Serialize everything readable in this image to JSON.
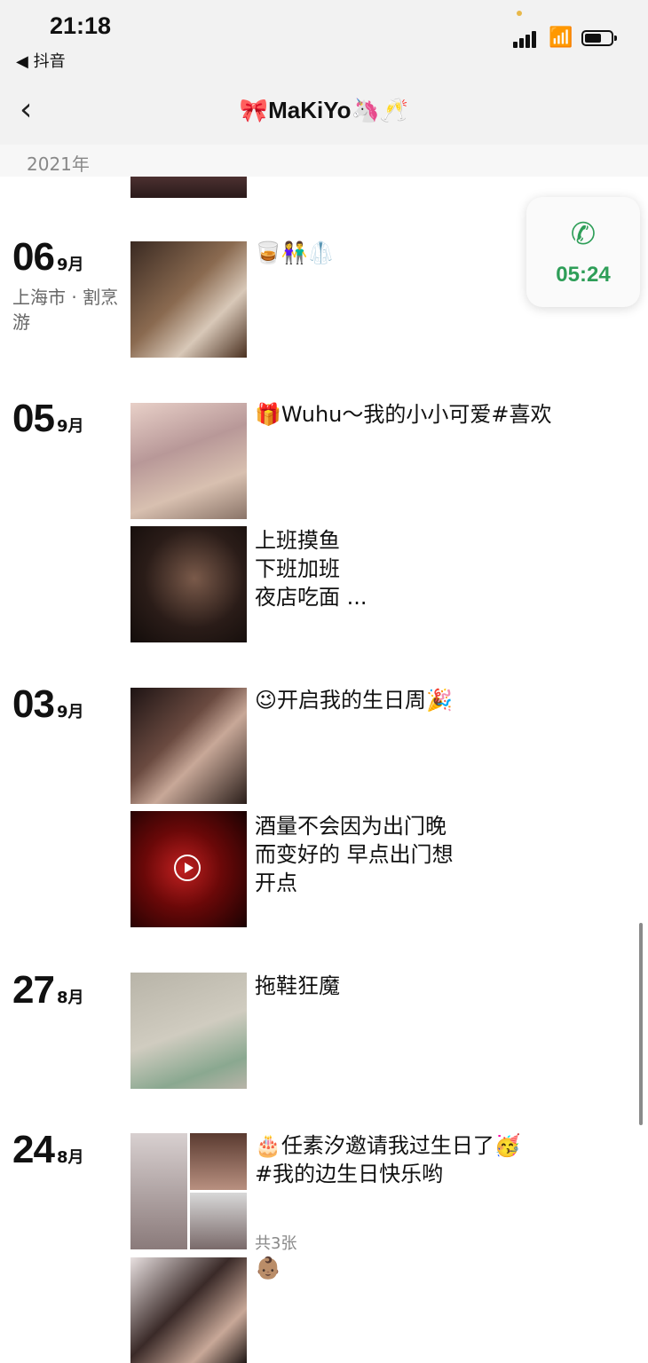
{
  "status": {
    "time": "21:18",
    "back_app": "◀ 抖音"
  },
  "nav": {
    "title": "🎀MaKiYo🦄🥂"
  },
  "year_label": "2021年",
  "call_widget": {
    "duration": "05:24",
    "icon": "phone-icon",
    "color": "#2e9e58"
  },
  "posts": [
    {
      "day": "06",
      "month": "9月",
      "location": "上海市 · 割烹游",
      "text": "🥃👫🥼"
    },
    {
      "day": "05",
      "month": "9月",
      "items": [
        {
          "text": "🎁Wuhu～我的小小可爱#喜欢"
        },
        {
          "text": "上班摸鱼\n下班加班\n夜店吃面 ..."
        }
      ]
    },
    {
      "day": "03",
      "month": "9月",
      "items": [
        {
          "text": "😉开启我的生日周🎉"
        },
        {
          "text": "酒量不会因为出门晚\n而变好的  早点出门想\n开点",
          "video": true
        }
      ]
    },
    {
      "day": "27",
      "month": "8月",
      "text": "拖鞋狂魔"
    },
    {
      "day": "24",
      "month": "8月",
      "items": [
        {
          "text": "🎂任素汐邀请我过生日了🥳\n#我的边生日快乐哟",
          "count": "共3张"
        },
        {
          "text": "👶🏽"
        }
      ]
    }
  ]
}
